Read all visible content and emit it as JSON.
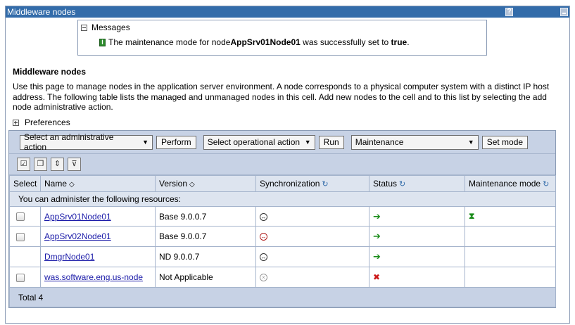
{
  "window": {
    "title": "Middleware nodes",
    "help_label": "?"
  },
  "messages": {
    "header": "Messages",
    "text_prefix": "The maintenance mode for node ",
    "node_name": "AppSrv01Node01",
    "text_middle": " was successfully set to ",
    "value": "true",
    "text_suffix": ".",
    "icon_letter": "I"
  },
  "page": {
    "title": "Middleware nodes",
    "description": "Use this page to manage nodes in the application server environment. A node corresponds to a physical computer system with a distinct IP host address. The following table lists the managed and unmanaged nodes in this cell. Add new nodes to the cell and to this list by selecting the add node administrative action.",
    "preferences_label": "Preferences"
  },
  "toolbar": {
    "admin_select": "Select an administrative action",
    "perform_label": "Perform",
    "op_select": "Select operational action",
    "run_label": "Run",
    "mode_select": "Maintenance",
    "setmode_label": "Set mode"
  },
  "icon_buttons": [
    "select-all-icon",
    "deselect-all-icon",
    "expand-filter-icon",
    "show-filter-icon"
  ],
  "table": {
    "headers": {
      "select": "Select",
      "name": "Name",
      "version": "Version",
      "sync": "Synchronization",
      "status": "Status",
      "maintenance": "Maintenance mode"
    },
    "group_label": "You can administer the following resources:",
    "rows": [
      {
        "name": "AppSrv01Node01",
        "version": "Base 9.0.0.7",
        "sync": "synchronized",
        "status": "started",
        "maintenance": "hourglass"
      },
      {
        "name": "AppSrv02Node01",
        "version": "Base 9.0.0.7",
        "sync": "not-synchronized",
        "status": "started",
        "maintenance": ""
      },
      {
        "name": "DmgrNode01",
        "version": "ND 9.0.0.7",
        "sync": "synchronized",
        "status": "started",
        "maintenance": ""
      },
      {
        "name": "was.software.eng.us-node",
        "version": "Not Applicable",
        "sync": "not-applicable",
        "status": "stopped",
        "maintenance": ""
      }
    ],
    "total": "Total 4"
  },
  "colors": {
    "titlebar": "#336caa",
    "toolbar_bg": "#c7d2e5",
    "header_bg": "#dde4ef",
    "link": "#1a1aa8"
  }
}
